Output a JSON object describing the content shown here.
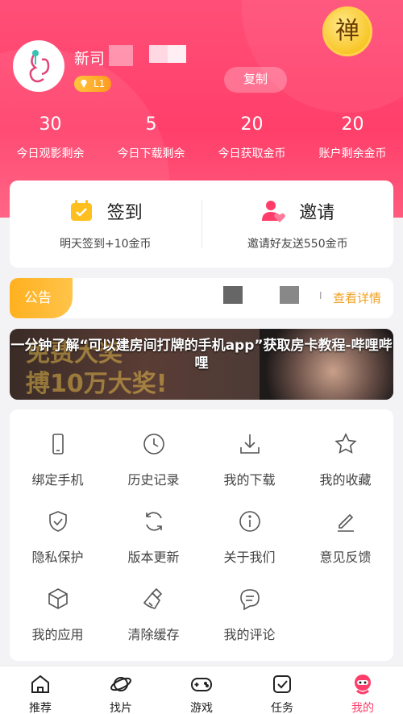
{
  "header": {
    "username": "新司",
    "level": "L1",
    "copy_label": "复制",
    "badge_char": "禅",
    "accent": "#ff4572"
  },
  "stats": [
    {
      "value": "30",
      "label": "今日观影剩余"
    },
    {
      "value": "5",
      "label": "今日下载剩余"
    },
    {
      "value": "20",
      "label": "今日获取金币"
    },
    {
      "value": "20",
      "label": "账户剩余金币"
    }
  ],
  "checkin": {
    "title": "签到",
    "subtitle": "明天签到+10金币",
    "icon": "calendar-check-icon"
  },
  "invite": {
    "title": "邀请",
    "subtitle": "邀请好友送550金币",
    "icon": "user-heart-icon"
  },
  "notice": {
    "tag": "公告",
    "bar_text": "I",
    "link": "查看详情"
  },
  "banner": {
    "bg_line1": "免费大奖",
    "bg_line2": "搏10万大奖!",
    "title": "一分钟了解“可以建房间打牌的手机app”获取房卡教程-哔哩哔哩"
  },
  "menu": [
    {
      "label": "绑定手机",
      "icon": "phone-icon"
    },
    {
      "label": "历史记录",
      "icon": "clock-icon"
    },
    {
      "label": "我的下载",
      "icon": "download-icon"
    },
    {
      "label": "我的收藏",
      "icon": "star-icon"
    },
    {
      "label": "隐私保护",
      "icon": "shield-icon"
    },
    {
      "label": "版本更新",
      "icon": "refresh-icon"
    },
    {
      "label": "关于我们",
      "icon": "info-icon"
    },
    {
      "label": "意见反馈",
      "icon": "edit-icon"
    },
    {
      "label": "我的应用",
      "icon": "cube-icon"
    },
    {
      "label": "清除缓存",
      "icon": "broom-icon"
    },
    {
      "label": "我的评论",
      "icon": "comment-icon"
    }
  ],
  "tabs": [
    {
      "label": "推荐",
      "icon": "home-icon"
    },
    {
      "label": "找片",
      "icon": "planet-icon"
    },
    {
      "label": "游戏",
      "icon": "gamepad-icon"
    },
    {
      "label": "任务",
      "icon": "task-icon"
    },
    {
      "label": "我的",
      "icon": "profile-icon"
    }
  ]
}
